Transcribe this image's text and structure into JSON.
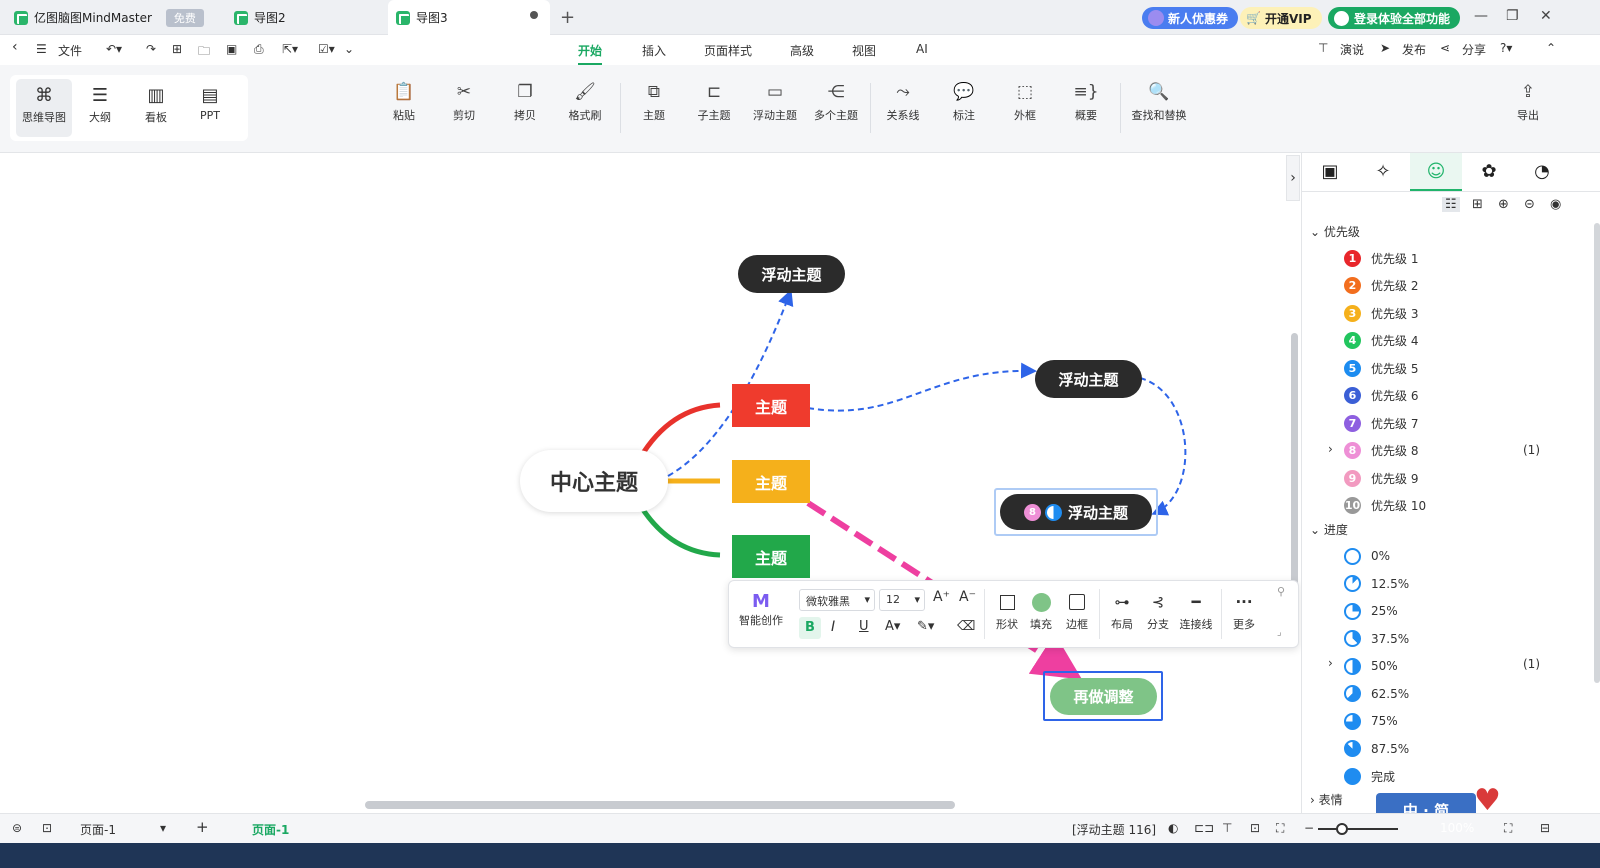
{
  "titlebar": {
    "app_tab": "亿图脑图MindMaster",
    "app_badge": "免费",
    "tab2": "导图2",
    "tab3": "导图3",
    "new_user": "新人优惠券",
    "vip": "开通VIP",
    "login": "登录体验全部功能"
  },
  "menubar": {
    "file": "文件",
    "tabs": [
      "开始",
      "插入",
      "页面样式",
      "高级",
      "视图",
      "AI"
    ],
    "present": "演说",
    "publish": "发布",
    "share": "分享"
  },
  "ribbon": {
    "views": [
      "思维导图",
      "大纲",
      "看板",
      "PPT"
    ],
    "tools": [
      "粘贴",
      "剪切",
      "拷贝",
      "格式刷",
      "主题",
      "子主题",
      "浮动主题",
      "多个主题",
      "关系线",
      "标注",
      "外框",
      "概要",
      "查找和替换"
    ],
    "export": "导出"
  },
  "canvas": {
    "central": "中心主题",
    "topic_red": "主题",
    "topic_orange": "主题",
    "topic_green": "主题",
    "float1": "浮动主题",
    "float2": "浮动主题",
    "float3": "浮动主题",
    "float3_marker": "8",
    "redo": "再做调整"
  },
  "float_toolbar": {
    "ai": "智能创作",
    "font": "微软雅黑",
    "size": "12",
    "labels": [
      "形状",
      "填充",
      "边框",
      "布局",
      "分支",
      "连接线",
      "更多"
    ]
  },
  "panel": {
    "priority_title": "优先级",
    "priorities": [
      {
        "num": "1",
        "label": "优先级 1",
        "color": "#e8262b"
      },
      {
        "num": "2",
        "label": "优先级 2",
        "color": "#f26e1e"
      },
      {
        "num": "3",
        "label": "优先级 3",
        "color": "#f5b01b"
      },
      {
        "num": "4",
        "label": "优先级 4",
        "color": "#22c55e"
      },
      {
        "num": "5",
        "label": "优先级 5",
        "color": "#1c8cf0"
      },
      {
        "num": "6",
        "label": "优先级 6",
        "color": "#3b5fd6"
      },
      {
        "num": "7",
        "label": "优先级 7",
        "color": "#8e5fe0"
      },
      {
        "num": "8",
        "label": "优先级 8",
        "color": "#ee8fd6"
      },
      {
        "num": "9",
        "label": "优先级 9",
        "color": "#f29ac0"
      },
      {
        "num": "10",
        "label": "优先级 10",
        "color": "#999999"
      }
    ],
    "priority8_count": "(1)",
    "progress_title": "进度",
    "progress": [
      "0%",
      "12.5%",
      "25%",
      "37.5%",
      "50%",
      "62.5%",
      "75%",
      "87.5%",
      "完成"
    ],
    "progress50_count": "(1)",
    "emotion_title": "表情"
  },
  "statusbar": {
    "page": "页面-1",
    "page_tab": "页面-1",
    "info": "[浮动主题 116]",
    "zoom": "100%"
  },
  "watermark": "中 · 简"
}
